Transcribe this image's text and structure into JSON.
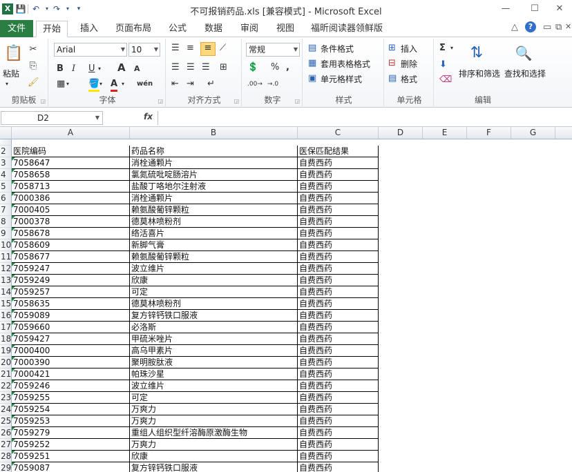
{
  "app": {
    "title": "不可报销药品.xls  [兼容模式]  -  Microsoft Excel",
    "logo": "X",
    "colors": {
      "accent": "#2a7e43",
      "grid": "#000000"
    }
  },
  "quick_access": {
    "icons": [
      "save-icon",
      "undo-icon",
      "redo-icon",
      "customize-icon"
    ]
  },
  "window": {
    "minimize": "—",
    "maximize": "☐",
    "close": "✕"
  },
  "tabs": {
    "file": "文件",
    "items": [
      "开始",
      "插入",
      "页面布局",
      "公式",
      "数据",
      "审阅",
      "视图",
      "福昕阅读器领鲜版"
    ],
    "active": "开始"
  },
  "ribbon": {
    "clipboard": {
      "paste": "粘贴",
      "label": "剪贴板"
    },
    "font": {
      "name": "Arial",
      "size": "10",
      "label": "字体",
      "bold": "B",
      "italic": "I",
      "underline": "U",
      "grow": "A",
      "shrink": "A",
      "wen": "wén"
    },
    "alignment": {
      "label": "对齐方式"
    },
    "number": {
      "format": "常规",
      "percent": "%",
      "comma": ",",
      "label": "数字"
    },
    "styles": {
      "conditional": "条件格式",
      "table": "套用表格格式",
      "cell": "单元格样式",
      "label": "样式"
    },
    "cells": {
      "insert": "插入",
      "delete": "删除",
      "format": "格式",
      "label": "单元格"
    },
    "editing": {
      "sigma": "Σ",
      "sort": "排序和筛选",
      "find": "查找和选择",
      "label": "编辑"
    }
  },
  "formula_bar": {
    "name_box": "D2",
    "fx": "fx",
    "formula": ""
  },
  "sheet": {
    "columns": [
      "A",
      "B",
      "C",
      "D",
      "E",
      "F",
      "G"
    ],
    "header_row": {
      "num": "2",
      "a": "医院编码",
      "b": "药品名称",
      "c": "医保匹配结果"
    },
    "rows": [
      {
        "num": "3",
        "a": "7058647",
        "b": "消栓通颗片",
        "c": "自费西药"
      },
      {
        "num": "4",
        "a": "7058658",
        "b": "氯氮硫吡啶肠溶片",
        "c": "自费西药"
      },
      {
        "num": "5",
        "a": "7058713",
        "b": "盐酸丁咯地尔注射液",
        "c": "自费西药"
      },
      {
        "num": "6",
        "a": "7000386",
        "b": "消栓通颗片",
        "c": "自费西药"
      },
      {
        "num": "7",
        "a": "7000405",
        "b": "赖氨酸葡锌颗粒",
        "c": "自费西药"
      },
      {
        "num": "8",
        "a": "7000378",
        "b": "德莫林喷粉剂",
        "c": "自费西药"
      },
      {
        "num": "9",
        "a": "7058678",
        "b": "络活喜片",
        "c": "自费西药"
      },
      {
        "num": "10",
        "a": "7058609",
        "b": "新脚气膏",
        "c": "自费西药"
      },
      {
        "num": "11",
        "a": "7058677",
        "b": "赖氨酸葡锌颗粒",
        "c": "自费西药"
      },
      {
        "num": "12",
        "a": "7059247",
        "b": "波立维片",
        "c": "自费西药"
      },
      {
        "num": "13",
        "a": "7059249",
        "b": "欣康",
        "c": "自费西药"
      },
      {
        "num": "14",
        "a": "7059257",
        "b": "可定",
        "c": "自费西药"
      },
      {
        "num": "15",
        "a": "7058635",
        "b": "德莫林喷粉剂",
        "c": "自费西药"
      },
      {
        "num": "16",
        "a": "7059089",
        "b": "复方锌钙铁口服液",
        "c": "自费西药"
      },
      {
        "num": "17",
        "a": "7059660",
        "b": "必洛斯",
        "c": "自费西药"
      },
      {
        "num": "18",
        "a": "7059427",
        "b": "甲硫米唑片",
        "c": "自费西药"
      },
      {
        "num": "19",
        "a": "7000400",
        "b": "高乌甲素片",
        "c": "自费西药"
      },
      {
        "num": "20",
        "a": "7000390",
        "b": "聚明胺肽液",
        "c": "自费西药"
      },
      {
        "num": "21",
        "a": "7000421",
        "b": "帕珠沙星",
        "c": "自费西药"
      },
      {
        "num": "22",
        "a": "7059246",
        "b": "波立维片",
        "c": "自费西药"
      },
      {
        "num": "23",
        "a": "7059255",
        "b": "可定",
        "c": "自费西药"
      },
      {
        "num": "24",
        "a": "7059254",
        "b": "万爽力",
        "c": "自费西药"
      },
      {
        "num": "25",
        "a": "7059253",
        "b": "万爽力",
        "c": "自费西药"
      },
      {
        "num": "26",
        "a": "7059279",
        "b": "重组人组织型纤溶酶原激酶生物",
        "c": "自费西药"
      },
      {
        "num": "27",
        "a": "7059252",
        "b": "万爽力",
        "c": "自费西药"
      },
      {
        "num": "28",
        "a": "7059251",
        "b": "欣康",
        "c": "自费西药"
      },
      {
        "num": "29",
        "a": "7059087",
        "b": "复方锌钙铁口服液",
        "c": "自费西药"
      }
    ]
  }
}
